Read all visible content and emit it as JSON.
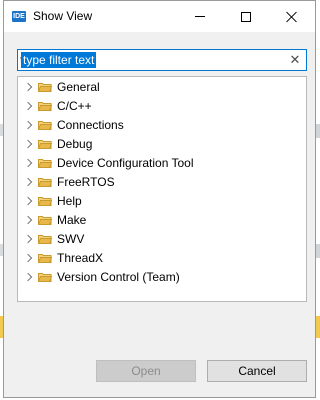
{
  "window": {
    "icon_text": "IDE",
    "title": "Show View"
  },
  "filter": {
    "value": "type filter text",
    "clear_glyph": "✕"
  },
  "tree": {
    "items": [
      {
        "label": "General"
      },
      {
        "label": "C/C++"
      },
      {
        "label": "Connections"
      },
      {
        "label": "Debug"
      },
      {
        "label": "Device Configuration Tool"
      },
      {
        "label": "FreeRTOS"
      },
      {
        "label": "Help"
      },
      {
        "label": "Make"
      },
      {
        "label": "SWV"
      },
      {
        "label": "ThreadX"
      },
      {
        "label": "Version Control (Team)"
      }
    ]
  },
  "buttons": {
    "open": "Open",
    "cancel": "Cancel"
  },
  "colors": {
    "accent": "#0078d7",
    "folder": "#e8b84a"
  }
}
